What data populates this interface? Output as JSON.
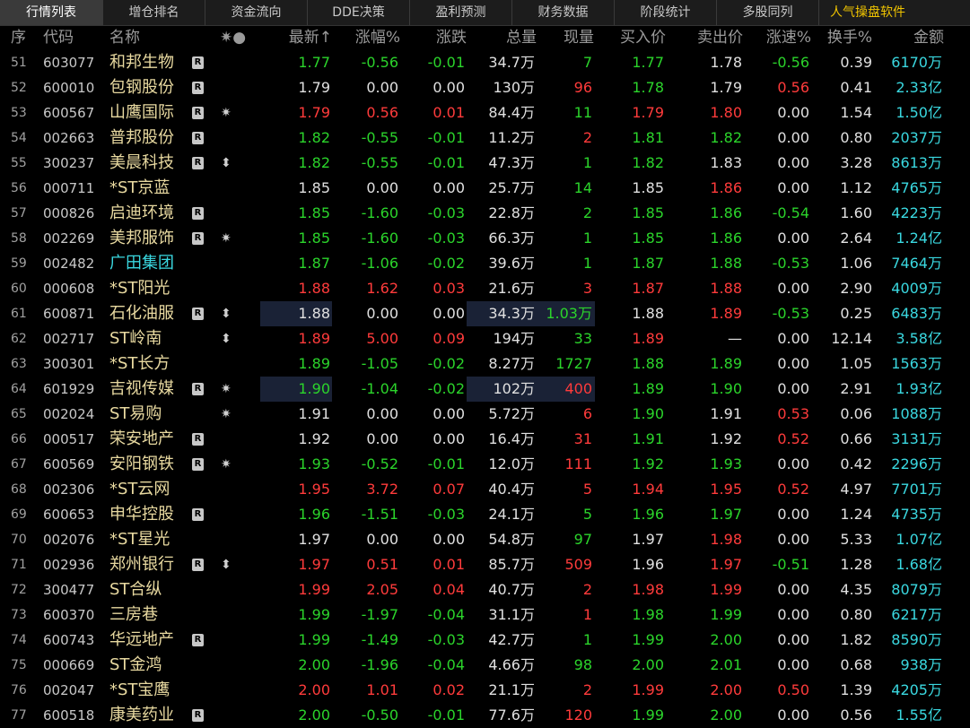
{
  "tabs": [
    {
      "label": "行情列表",
      "active": true
    },
    {
      "label": "增仓排名"
    },
    {
      "label": "资金流向"
    },
    {
      "label": "DDE决策"
    },
    {
      "label": "盈利预测"
    },
    {
      "label": "财务数据"
    },
    {
      "label": "阶段统计"
    },
    {
      "label": "多股同列"
    },
    {
      "label": "人气操盘软件",
      "hot": true
    }
  ],
  "columns": [
    "序",
    "代码",
    "名称",
    "✷●",
    "最新↑",
    "涨幅%",
    "涨跌",
    "总量",
    "现量",
    "买入价",
    "卖出价",
    "涨速%",
    "换手%",
    "金额"
  ],
  "colors": {
    "up": "#ff3b3b",
    "down": "#2bd42b",
    "flat": "#e0e0e0",
    "amount": "#3ad8e0",
    "name": "#e8d9a0"
  },
  "rows": [
    {
      "seq": "51",
      "code": "603077",
      "name": "和邦生物",
      "badge": "R",
      "mark": "",
      "last": "1.77",
      "pct": "-0.56",
      "chg": "-0.01",
      "vol": "34.7万",
      "cur": "7",
      "bid": "1.77",
      "ask": "1.78",
      "spd": "-0.56",
      "turn": "0.39",
      "amt": "6170万",
      "c": {
        "last": "g",
        "pct": "g",
        "chg": "g",
        "cur": "g",
        "bid": "g",
        "ask": "w",
        "spd": "g"
      }
    },
    {
      "seq": "52",
      "code": "600010",
      "name": "包钢股份",
      "badge": "R",
      "mark": "",
      "last": "1.79",
      "pct": "0.00",
      "chg": "0.00",
      "vol": "130万",
      "cur": "96",
      "bid": "1.78",
      "ask": "1.79",
      "spd": "0.56",
      "turn": "0.41",
      "amt": "2.33亿",
      "c": {
        "last": "w",
        "pct": "w",
        "chg": "w",
        "cur": "red",
        "bid": "g",
        "ask": "w",
        "spd": "red"
      }
    },
    {
      "seq": "53",
      "code": "600567",
      "name": "山鹰国际",
      "badge": "R",
      "mark": "✷",
      "last": "1.79",
      "pct": "0.56",
      "chg": "0.01",
      "vol": "84.4万",
      "cur": "11",
      "bid": "1.79",
      "ask": "1.80",
      "spd": "0.00",
      "turn": "1.54",
      "amt": "1.50亿",
      "c": {
        "last": "red",
        "pct": "red",
        "chg": "red",
        "cur": "g",
        "bid": "red",
        "ask": "red",
        "spd": "w"
      }
    },
    {
      "seq": "54",
      "code": "002663",
      "name": "普邦股份",
      "badge": "R",
      "mark": "",
      "last": "1.82",
      "pct": "-0.55",
      "chg": "-0.01",
      "vol": "11.2万",
      "cur": "2",
      "bid": "1.81",
      "ask": "1.82",
      "spd": "0.00",
      "turn": "0.80",
      "amt": "2037万",
      "c": {
        "last": "g",
        "pct": "g",
        "chg": "g",
        "cur": "red",
        "bid": "g",
        "ask": "g",
        "spd": "w"
      }
    },
    {
      "seq": "55",
      "code": "300237",
      "name": "美晨科技",
      "badge": "R",
      "mark": "⬍",
      "last": "1.82",
      "pct": "-0.55",
      "chg": "-0.01",
      "vol": "47.3万",
      "cur": "1",
      "bid": "1.82",
      "ask": "1.83",
      "spd": "0.00",
      "turn": "3.28",
      "amt": "8613万",
      "c": {
        "last": "g",
        "pct": "g",
        "chg": "g",
        "cur": "g",
        "bid": "g",
        "ask": "w",
        "spd": "w"
      }
    },
    {
      "seq": "56",
      "code": "000711",
      "name": "*ST京蓝",
      "badge": "",
      "mark": "",
      "last": "1.85",
      "pct": "0.00",
      "chg": "0.00",
      "vol": "25.7万",
      "cur": "14",
      "bid": "1.85",
      "ask": "1.86",
      "spd": "0.00",
      "turn": "1.12",
      "amt": "4765万",
      "c": {
        "last": "w",
        "pct": "w",
        "chg": "w",
        "cur": "g",
        "bid": "w",
        "ask": "red",
        "spd": "w"
      }
    },
    {
      "seq": "57",
      "code": "000826",
      "name": "启迪环境",
      "badge": "R",
      "mark": "",
      "last": "1.85",
      "pct": "-1.60",
      "chg": "-0.03",
      "vol": "22.8万",
      "cur": "2",
      "bid": "1.85",
      "ask": "1.86",
      "spd": "-0.54",
      "turn": "1.60",
      "amt": "4223万",
      "c": {
        "last": "g",
        "pct": "g",
        "chg": "g",
        "cur": "g",
        "bid": "g",
        "ask": "g",
        "spd": "g"
      }
    },
    {
      "seq": "58",
      "code": "002269",
      "name": "美邦服饰",
      "badge": "R",
      "mark": "✷",
      "last": "1.85",
      "pct": "-1.60",
      "chg": "-0.03",
      "vol": "66.3万",
      "cur": "1",
      "bid": "1.85",
      "ask": "1.86",
      "spd": "0.00",
      "turn": "2.64",
      "amt": "1.24亿",
      "c": {
        "last": "g",
        "pct": "g",
        "chg": "g",
        "cur": "g",
        "bid": "g",
        "ask": "g",
        "spd": "w"
      }
    },
    {
      "seq": "59",
      "code": "002482",
      "name": "广田集团",
      "badge": "",
      "mark": "",
      "cyanName": true,
      "last": "1.87",
      "pct": "-1.06",
      "chg": "-0.02",
      "vol": "39.6万",
      "cur": "1",
      "bid": "1.87",
      "ask": "1.88",
      "spd": "-0.53",
      "turn": "1.06",
      "amt": "7464万",
      "c": {
        "last": "g",
        "pct": "g",
        "chg": "g",
        "cur": "g",
        "bid": "g",
        "ask": "g",
        "spd": "g"
      }
    },
    {
      "seq": "60",
      "code": "000608",
      "name": "*ST阳光",
      "badge": "",
      "mark": "",
      "last": "1.88",
      "pct": "1.62",
      "chg": "0.03",
      "vol": "21.6万",
      "cur": "3",
      "bid": "1.87",
      "ask": "1.88",
      "spd": "0.00",
      "turn": "2.90",
      "amt": "4009万",
      "c": {
        "last": "red",
        "pct": "red",
        "chg": "red",
        "cur": "red",
        "bid": "red",
        "ask": "red",
        "spd": "w"
      }
    },
    {
      "seq": "61",
      "code": "600871",
      "name": "石化油服",
      "badge": "R",
      "mark": "⬍",
      "hl": true,
      "last": "1.88",
      "pct": "0.00",
      "chg": "0.00",
      "vol": "34.3万",
      "cur": "1.03万",
      "bid": "1.88",
      "ask": "1.89",
      "spd": "-0.53",
      "turn": "0.25",
      "amt": "6483万",
      "c": {
        "last": "w",
        "pct": "w",
        "chg": "w",
        "cur": "g",
        "bid": "w",
        "ask": "red",
        "spd": "g"
      }
    },
    {
      "seq": "62",
      "code": "002717",
      "name": "ST岭南",
      "badge": "",
      "mark": "⬍",
      "last": "1.89",
      "pct": "5.00",
      "chg": "0.09",
      "vol": "194万",
      "cur": "33",
      "bid": "1.89",
      "ask": "—",
      "spd": "0.00",
      "turn": "12.14",
      "amt": "3.58亿",
      "c": {
        "last": "red",
        "pct": "red",
        "chg": "red",
        "cur": "g",
        "bid": "red",
        "ask": "w",
        "spd": "w"
      }
    },
    {
      "seq": "63",
      "code": "300301",
      "name": "*ST长方",
      "badge": "",
      "mark": "",
      "last": "1.89",
      "pct": "-1.05",
      "chg": "-0.02",
      "vol": "8.27万",
      "cur": "1727",
      "bid": "1.88",
      "ask": "1.89",
      "spd": "0.00",
      "turn": "1.05",
      "amt": "1563万",
      "c": {
        "last": "g",
        "pct": "g",
        "chg": "g",
        "cur": "g",
        "bid": "g",
        "ask": "g",
        "spd": "w"
      }
    },
    {
      "seq": "64",
      "code": "601929",
      "name": "吉视传媒",
      "badge": "R",
      "mark": "✷",
      "hl": true,
      "last": "1.90",
      "pct": "-1.04",
      "chg": "-0.02",
      "vol": "102万",
      "cur": "400",
      "bid": "1.89",
      "ask": "1.90",
      "spd": "0.00",
      "turn": "2.91",
      "amt": "1.93亿",
      "c": {
        "last": "g",
        "pct": "g",
        "chg": "g",
        "cur": "red",
        "bid": "g",
        "ask": "g",
        "spd": "w"
      }
    },
    {
      "seq": "65",
      "code": "002024",
      "name": "ST易购",
      "badge": "",
      "mark": "✷",
      "last": "1.91",
      "pct": "0.00",
      "chg": "0.00",
      "vol": "5.72万",
      "cur": "6",
      "bid": "1.90",
      "ask": "1.91",
      "spd": "0.53",
      "turn": "0.06",
      "amt": "1088万",
      "c": {
        "last": "w",
        "pct": "w",
        "chg": "w",
        "cur": "red",
        "bid": "g",
        "ask": "w",
        "spd": "red"
      }
    },
    {
      "seq": "66",
      "code": "000517",
      "name": "荣安地产",
      "badge": "R",
      "mark": "",
      "last": "1.92",
      "pct": "0.00",
      "chg": "0.00",
      "vol": "16.4万",
      "cur": "31",
      "bid": "1.91",
      "ask": "1.92",
      "spd": "0.52",
      "turn": "0.66",
      "amt": "3131万",
      "c": {
        "last": "w",
        "pct": "w",
        "chg": "w",
        "cur": "red",
        "bid": "g",
        "ask": "w",
        "spd": "red"
      }
    },
    {
      "seq": "67",
      "code": "600569",
      "name": "安阳钢铁",
      "badge": "R",
      "mark": "✷",
      "last": "1.93",
      "pct": "-0.52",
      "chg": "-0.01",
      "vol": "12.0万",
      "cur": "111",
      "bid": "1.92",
      "ask": "1.93",
      "spd": "0.00",
      "turn": "0.42",
      "amt": "2296万",
      "c": {
        "last": "g",
        "pct": "g",
        "chg": "g",
        "cur": "red",
        "bid": "g",
        "ask": "g",
        "spd": "w"
      }
    },
    {
      "seq": "68",
      "code": "002306",
      "name": "*ST云网",
      "badge": "",
      "mark": "",
      "last": "1.95",
      "pct": "3.72",
      "chg": "0.07",
      "vol": "40.4万",
      "cur": "5",
      "bid": "1.94",
      "ask": "1.95",
      "spd": "0.52",
      "turn": "4.97",
      "amt": "7701万",
      "c": {
        "last": "red",
        "pct": "red",
        "chg": "red",
        "cur": "red",
        "bid": "red",
        "ask": "red",
        "spd": "red"
      }
    },
    {
      "seq": "69",
      "code": "600653",
      "name": "申华控股",
      "badge": "R",
      "mark": "",
      "last": "1.96",
      "pct": "-1.51",
      "chg": "-0.03",
      "vol": "24.1万",
      "cur": "5",
      "bid": "1.96",
      "ask": "1.97",
      "spd": "0.00",
      "turn": "1.24",
      "amt": "4735万",
      "c": {
        "last": "g",
        "pct": "g",
        "chg": "g",
        "cur": "g",
        "bid": "g",
        "ask": "g",
        "spd": "w"
      }
    },
    {
      "seq": "70",
      "code": "002076",
      "name": "*ST星光",
      "badge": "",
      "mark": "",
      "last": "1.97",
      "pct": "0.00",
      "chg": "0.00",
      "vol": "54.8万",
      "cur": "97",
      "bid": "1.97",
      "ask": "1.98",
      "spd": "0.00",
      "turn": "5.33",
      "amt": "1.07亿",
      "c": {
        "last": "w",
        "pct": "w",
        "chg": "w",
        "cur": "g",
        "bid": "w",
        "ask": "red",
        "spd": "w"
      }
    },
    {
      "seq": "71",
      "code": "002936",
      "name": "郑州银行",
      "badge": "R",
      "mark": "⬍",
      "last": "1.97",
      "pct": "0.51",
      "chg": "0.01",
      "vol": "85.7万",
      "cur": "509",
      "bid": "1.96",
      "ask": "1.97",
      "spd": "-0.51",
      "turn": "1.28",
      "amt": "1.68亿",
      "c": {
        "last": "red",
        "pct": "red",
        "chg": "red",
        "cur": "red",
        "bid": "w",
        "ask": "red",
        "spd": "g"
      }
    },
    {
      "seq": "72",
      "code": "300477",
      "name": "ST合纵",
      "badge": "",
      "mark": "",
      "last": "1.99",
      "pct": "2.05",
      "chg": "0.04",
      "vol": "40.7万",
      "cur": "2",
      "bid": "1.98",
      "ask": "1.99",
      "spd": "0.00",
      "turn": "4.35",
      "amt": "8079万",
      "c": {
        "last": "red",
        "pct": "red",
        "chg": "red",
        "cur": "red",
        "bid": "red",
        "ask": "red",
        "spd": "w"
      }
    },
    {
      "seq": "73",
      "code": "600370",
      "name": "三房巷",
      "badge": "",
      "mark": "",
      "last": "1.99",
      "pct": "-1.97",
      "chg": "-0.04",
      "vol": "31.1万",
      "cur": "1",
      "bid": "1.98",
      "ask": "1.99",
      "spd": "0.00",
      "turn": "0.80",
      "amt": "6217万",
      "c": {
        "last": "g",
        "pct": "g",
        "chg": "g",
        "cur": "red",
        "bid": "g",
        "ask": "g",
        "spd": "w"
      }
    },
    {
      "seq": "74",
      "code": "600743",
      "name": "华远地产",
      "badge": "R",
      "mark": "",
      "last": "1.99",
      "pct": "-1.49",
      "chg": "-0.03",
      "vol": "42.7万",
      "cur": "1",
      "bid": "1.99",
      "ask": "2.00",
      "spd": "0.00",
      "turn": "1.82",
      "amt": "8590万",
      "c": {
        "last": "g",
        "pct": "g",
        "chg": "g",
        "cur": "g",
        "bid": "g",
        "ask": "g",
        "spd": "w"
      }
    },
    {
      "seq": "75",
      "code": "000669",
      "name": "ST金鸿",
      "badge": "",
      "mark": "",
      "last": "2.00",
      "pct": "-1.96",
      "chg": "-0.04",
      "vol": "4.66万",
      "cur": "98",
      "bid": "2.00",
      "ask": "2.01",
      "spd": "0.00",
      "turn": "0.68",
      "amt": "938万",
      "c": {
        "last": "g",
        "pct": "g",
        "chg": "g",
        "cur": "g",
        "bid": "g",
        "ask": "g",
        "spd": "w"
      }
    },
    {
      "seq": "76",
      "code": "002047",
      "name": "*ST宝鹰",
      "badge": "",
      "mark": "",
      "last": "2.00",
      "pct": "1.01",
      "chg": "0.02",
      "vol": "21.1万",
      "cur": "2",
      "bid": "1.99",
      "ask": "2.00",
      "spd": "0.50",
      "turn": "1.39",
      "amt": "4205万",
      "c": {
        "last": "red",
        "pct": "red",
        "chg": "red",
        "cur": "red",
        "bid": "red",
        "ask": "red",
        "spd": "red"
      }
    },
    {
      "seq": "77",
      "code": "600518",
      "name": "康美药业",
      "badge": "R",
      "mark": "",
      "last": "2.00",
      "pct": "-0.50",
      "chg": "-0.01",
      "vol": "77.6万",
      "cur": "120",
      "bid": "1.99",
      "ask": "2.00",
      "spd": "0.00",
      "turn": "0.56",
      "amt": "1.55亿",
      "c": {
        "last": "g",
        "pct": "g",
        "chg": "g",
        "cur": "red",
        "bid": "g",
        "ask": "g",
        "spd": "w"
      }
    }
  ]
}
